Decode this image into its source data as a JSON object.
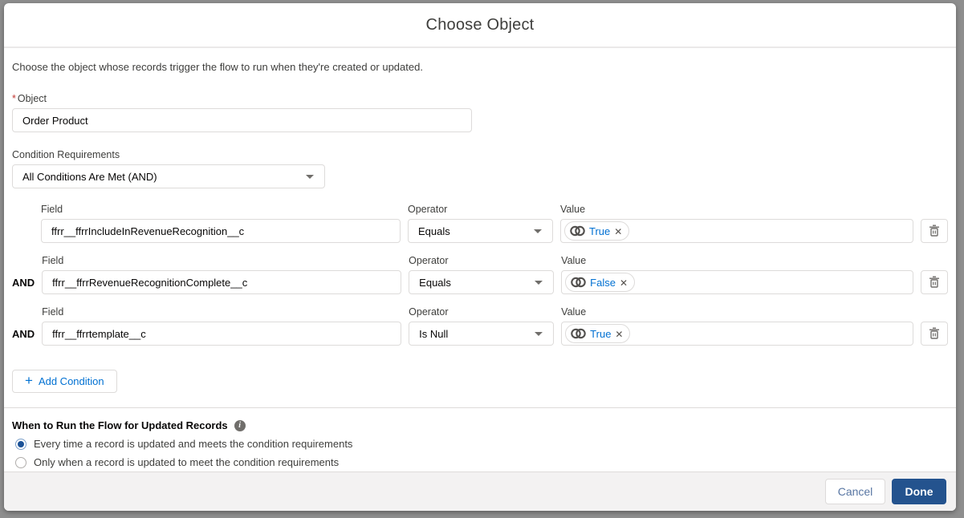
{
  "modal": {
    "title": "Choose Object",
    "description": "Choose the object whose records trigger the flow to run when they're created or updated.",
    "object_field": {
      "required_marker": "*",
      "label": "Object",
      "value": "Order Product"
    },
    "condition_requirements": {
      "label": "Condition Requirements",
      "value": "All Conditions Are Met (AND)"
    },
    "columns": {
      "field": "Field",
      "operator": "Operator",
      "value": "Value"
    },
    "conditions": [
      {
        "prefix": "",
        "field": "ffrr__ffrrIncludeInRevenueRecognition__c",
        "operator": "Equals",
        "value": "True"
      },
      {
        "prefix": "AND",
        "field": "ffrr__ffrrRevenueRecognitionComplete__c",
        "operator": "Equals",
        "value": "False"
      },
      {
        "prefix": "AND",
        "field": "ffrr__ffrrtemplate__c",
        "operator": "Is Null",
        "value": "True"
      }
    ],
    "add_condition": {
      "plus": "+",
      "label": "Add Condition"
    },
    "when_to_run": {
      "heading": "When to Run the Flow for Updated Records",
      "info_glyph": "i",
      "options": [
        {
          "label": "Every time a record is updated and meets the condition requirements"
        },
        {
          "label": "Only when a record is updated to meet the condition requirements"
        }
      ]
    },
    "footer": {
      "cancel_label": "Cancel",
      "done_label": "Done"
    },
    "pill_remove_glyph": "✕",
    "colors": {
      "accent_blue": "#0070d2",
      "done_bg": "#24538e",
      "required_red": "#c23934"
    }
  }
}
